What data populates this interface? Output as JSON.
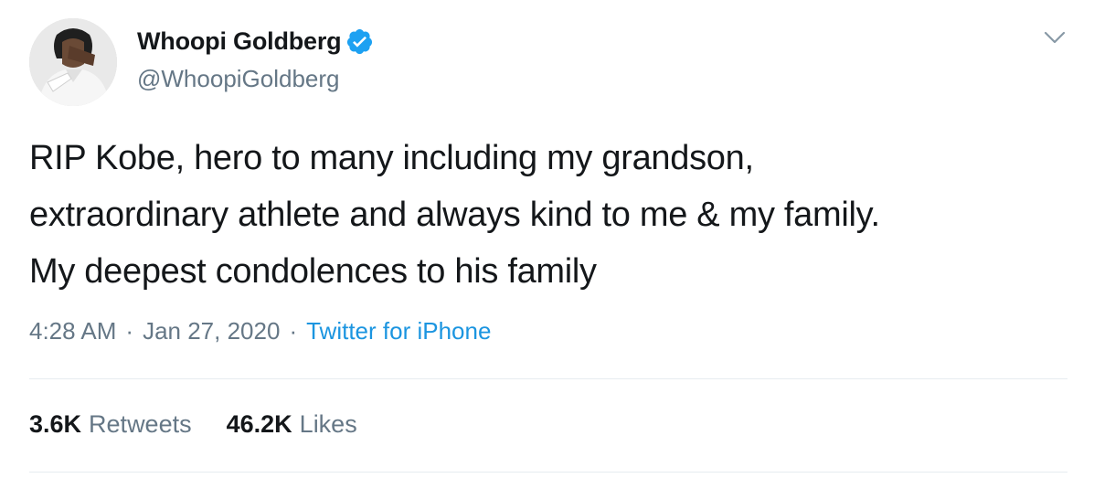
{
  "author": {
    "display_name": "Whoopi Goldberg",
    "handle": "@WhoopiGoldberg",
    "verified": true
  },
  "tweet": {
    "text": "RIP Kobe, hero to many including my grandson,\nextraordinary athlete and always  kind to me & my family.\nMy deepest condolences to his family",
    "time": "4:28 AM",
    "date": "Jan 27, 2020",
    "separator": "·",
    "source": "Twitter for iPhone"
  },
  "stats": {
    "retweets_count": "3.6K",
    "retweets_label": "Retweets",
    "likes_count": "46.2K",
    "likes_label": "Likes"
  },
  "colors": {
    "text_primary": "#14171a",
    "text_secondary": "#657786",
    "link": "#1b95e0",
    "verified": "#1da1f2",
    "divider": "#e6ecf0"
  },
  "icons": {
    "verified": "verified-badge-icon",
    "caret": "chevron-down-icon"
  }
}
